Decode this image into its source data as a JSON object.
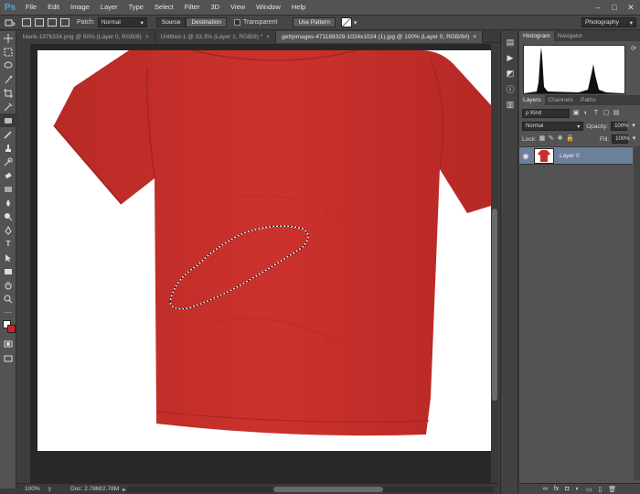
{
  "app": {
    "logo": "Ps"
  },
  "menu": [
    "File",
    "Edit",
    "Image",
    "Layer",
    "Type",
    "Select",
    "Filter",
    "3D",
    "View",
    "Window",
    "Help"
  ],
  "window_controls": [
    "–",
    "□",
    "✕"
  ],
  "options": {
    "patch_label": "Patch:",
    "patch_mode": "Normal",
    "source_label": "Source",
    "destination_label": "Destination",
    "transparent_label": "Transparent",
    "use_pattern_label": "Use Pattern",
    "workspace": "Photography"
  },
  "tabs": [
    {
      "label": "blank-1976334.png @ 50% (Layer 0, RGB/8)",
      "close": "×"
    },
    {
      "label": "Untitled-1 @ 33.3% (Layer 1, RGB/8) *",
      "close": "×"
    },
    {
      "label": "gettyimages-471188329-1024x1024 (1).jpg @ 100% (Layer 0, RGB/8#)",
      "close": "×"
    }
  ],
  "status": {
    "zoom": "100%",
    "doc": "Doc: 2.78M/2.78M"
  },
  "panels": {
    "histogram_tab": "Histogram",
    "navigator_tab": "Navigator",
    "layers_tab": "Layers",
    "channels_tab": "Channels",
    "paths_tab": "Paths",
    "kind_filter": "ρ Kind",
    "blend_mode": "Normal",
    "opacity_label": "Opacity:",
    "opacity_value": "100%",
    "lock_label": "Lock:",
    "fill_label": "Fill:",
    "fill_value": "100%",
    "layer_name": "Layer 0",
    "bottom_icons": [
      "∞",
      "fx",
      "◘",
      "◐",
      "▭",
      "▯",
      "🗑"
    ]
  },
  "colors": {
    "shirt": "#c9302c",
    "foreground": "#ffffff",
    "background": "#d2232a",
    "selected_layer": "#6c7f9b"
  }
}
